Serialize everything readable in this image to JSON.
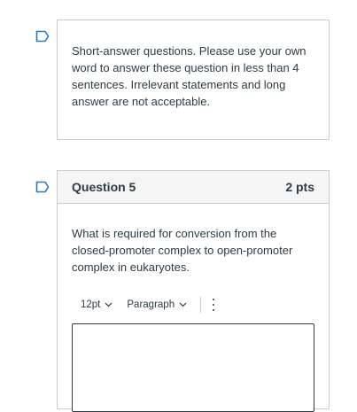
{
  "instructions": {
    "text": "Short-answer questions. Please use your own word to answer these question in less than 4 sentences. Irrelevant statements and long answer are not acceptable."
  },
  "question": {
    "title": "Question 5",
    "points": "2 pts",
    "text": "What is required for conversion from the closed-promoter complex to open-promoter complex in eukaryotes."
  },
  "editor": {
    "font_size": "12pt",
    "block_format": "Paragraph",
    "more_icon": "vertical-ellipsis-icon"
  },
  "icons": {
    "flag": "bookmark-flag-icon"
  },
  "colors": {
    "flag": "#2b7abc",
    "border": "#c7cdd1",
    "text": "#2d3b45",
    "header_bg": "#f5f5f5"
  }
}
